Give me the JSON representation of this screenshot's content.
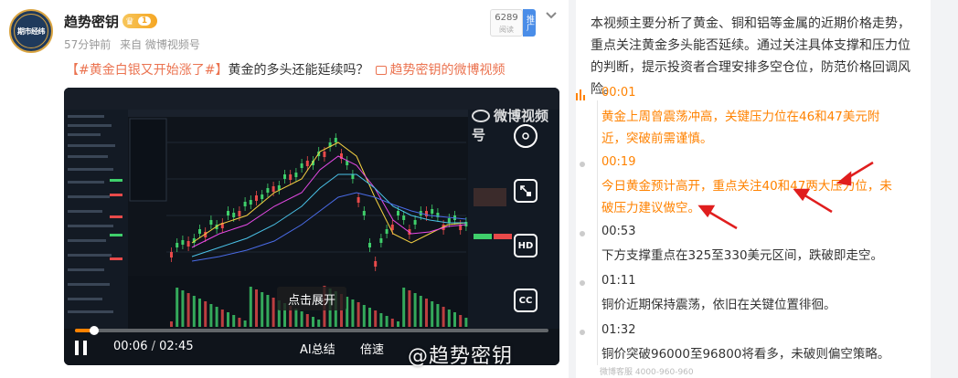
{
  "post": {
    "avatar_text": "期市经纬",
    "user_name": "趋势密钥",
    "vip_level": "1",
    "time": "57分钟前",
    "source": "来自 微博视频号",
    "ad_count": "6289",
    "ad_sub": "阅读",
    "promo_tag": "推广",
    "text_topic": "【#黄金白银又开始涨了#】",
    "text_body": "黄金的多头还能延续吗？",
    "text_link": "趋势密钥的微博视频"
  },
  "video": {
    "watermark": "微博视频号",
    "expand_label": "点击展开",
    "time_current": "00:06",
    "time_total": "02:45",
    "ai_summary": "AI总结",
    "speed": "倍速",
    "bottom_watermark": "@趋势密钥",
    "progress_fraction": 0.04,
    "side_buttons": [
      "pip-button",
      "hd-button",
      "cc-button"
    ],
    "hd_label": "HD",
    "cc_label": "CC"
  },
  "panel": {
    "summary": "本视频主要分析了黄金、铜和铝等金属的近期价格走势，重点关注黄金多头能否延续。通过关注具体支撑和压力位的判断，提示投资者合理安排多空仓位，防范价格回调风险。",
    "chapters": [
      {
        "time": "00:01",
        "desc": "黄金上周曾震荡冲高，关键压力位在46和47美元附近，突破前需谨慎。",
        "active": true
      },
      {
        "time": "00:19",
        "desc": "今日黄金预计高开，重点关注40和47两大压力位，未破压力建议做空。",
        "active": true
      },
      {
        "time": "00:53",
        "desc": "下方支撑重点在325至330美元区间，跌破即走空。",
        "active": false
      },
      {
        "time": "01:11",
        "desc": "铜价近期保持震荡，依旧在关键位置徘徊。",
        "active": false
      },
      {
        "time": "01:32",
        "desc": "铜价突破96000至96800将看多，未破则偏空策略。",
        "active": false
      }
    ],
    "footer": "微博客服 4000-960-960"
  },
  "colors": {
    "accent": "#ff8200",
    "topic": "#eb7350",
    "up": "#e84a4a",
    "down": "#3fcf6b"
  }
}
